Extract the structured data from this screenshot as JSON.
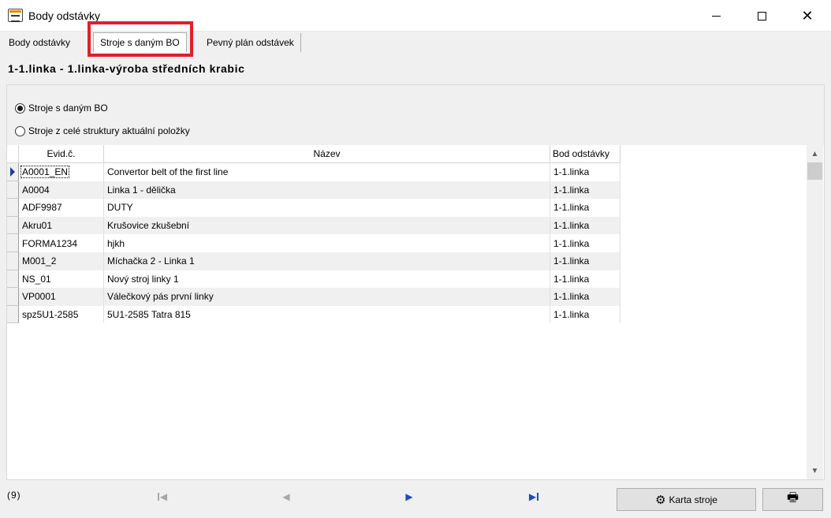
{
  "window": {
    "title": "Body odstávky"
  },
  "tabs": [
    {
      "label": "Body odstávky"
    },
    {
      "label": "Stroje s daným BO"
    },
    {
      "label": "Pevný plán odstávek"
    }
  ],
  "header": {
    "text": "1-1.linka - 1.linka-výroba středních krabic"
  },
  "radios": [
    {
      "label": "Stroje s daným BO",
      "checked": true
    },
    {
      "label": "Stroje z celé struktury aktuální položky",
      "checked": false
    }
  ],
  "grid": {
    "columns": [
      "Evid.č.",
      "Název",
      "Bod odstávky"
    ],
    "rows": [
      {
        "evid": "A0001_EN",
        "nazev": "Convertor belt of the first line",
        "bod": "1-1.linka"
      },
      {
        "evid": "A0004",
        "nazev": "Linka 1 - dělička",
        "bod": "1-1.linka"
      },
      {
        "evid": "ADF9987",
        "nazev": "DUTY",
        "bod": "1-1.linka"
      },
      {
        "evid": "Akru01",
        "nazev": "Krušovice zkušební",
        "bod": "1-1.linka"
      },
      {
        "evid": "FORMA1234",
        "nazev": "hjkh",
        "bod": "1-1.linka"
      },
      {
        "evid": "M001_2",
        "nazev": "Míchačka 2 - Linka 1",
        "bod": "1-1.linka"
      },
      {
        "evid": "NS_01",
        "nazev": "Nový stroj linky 1",
        "bod": "1-1.linka"
      },
      {
        "evid": "VP0001",
        "nazev": "Válečkový pás první linky",
        "bod": "1-1.linka"
      },
      {
        "evid": "spz5U1-2585",
        "nazev": "5U1-2585 Tatra 815",
        "bod": "1-1.linka"
      }
    ]
  },
  "footer": {
    "count": "(9)",
    "karta_label": "Karta stroje"
  },
  "icons": {
    "first": "first-record-icon",
    "prev": "previous-record-icon",
    "next": "next-record-icon",
    "last": "last-record-icon",
    "karta": "gear-icon",
    "print": "printer-icon"
  },
  "colors": {
    "highlight": "#e0202a",
    "nav_active": "#1d4fb8"
  }
}
